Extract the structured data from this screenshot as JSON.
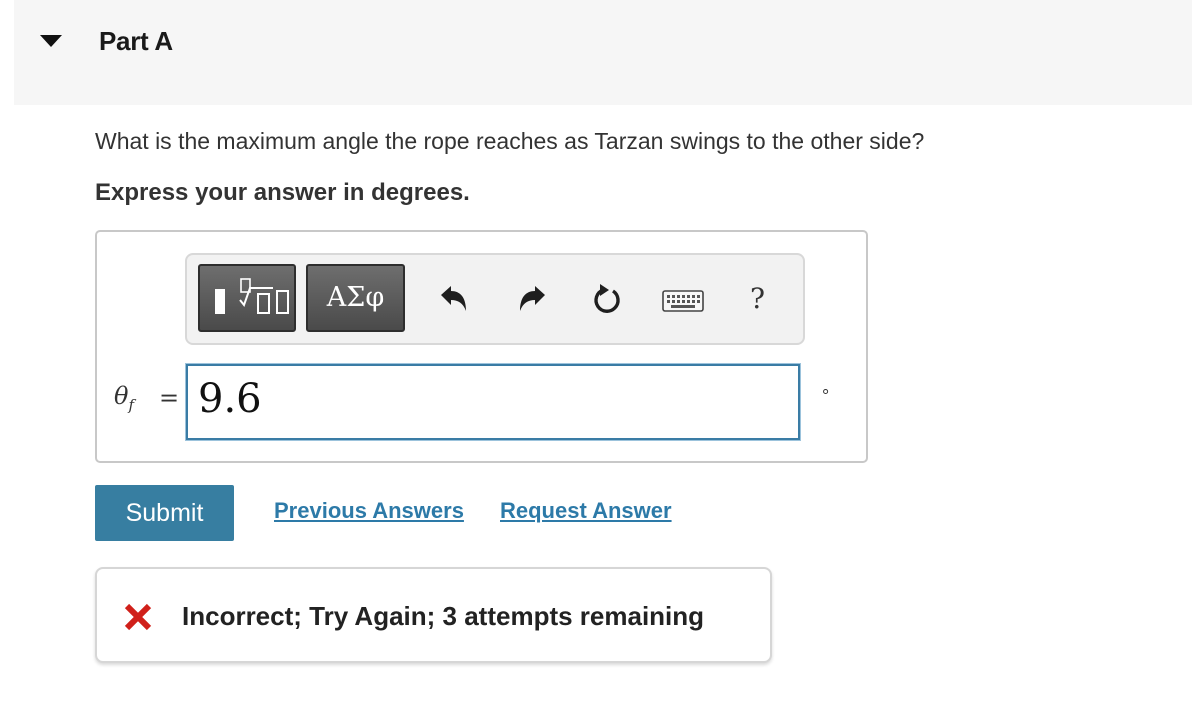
{
  "part": {
    "title": "Part A"
  },
  "question": {
    "text": "What is the maximum angle the rope reaches as Tarzan swings to the other side?",
    "instruction": "Express your answer in degrees."
  },
  "toolbar": {
    "greek_label": "ΑΣφ",
    "help_label": "?",
    "icons": [
      "templates-icon",
      "undo-icon",
      "redo-icon",
      "reset-icon",
      "keyboard-icon",
      "help-icon"
    ]
  },
  "answer": {
    "variable": "θ",
    "subscript": "f",
    "equals": "=",
    "value": "9.6",
    "unit": "°"
  },
  "actions": {
    "submit_label": "Submit",
    "previous_answers_label": "Previous Answers",
    "request_answer_label": "Request Answer"
  },
  "feedback": {
    "text": "Incorrect; Try Again; 3 attempts remaining",
    "status_color": "#d0201a"
  },
  "colors": {
    "accent": "#377ea1",
    "link": "#2d7aa8",
    "input_border": "#3a7ca5"
  }
}
